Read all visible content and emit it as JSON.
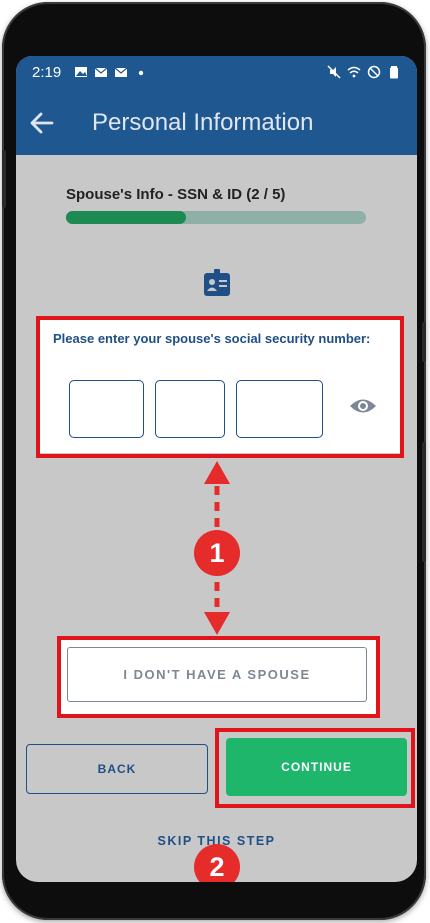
{
  "status_bar": {
    "time": "2:19",
    "left_icons": [
      "image-icon",
      "mail-icon",
      "mail-icon",
      "dot-icon"
    ],
    "right_icons": [
      "mute-icon",
      "wifi-icon",
      "do-not-disturb-icon",
      "battery-icon"
    ]
  },
  "app_bar": {
    "title": "Personal Information"
  },
  "progress": {
    "label": "Spouse's Info - SSN & ID (2 / 5)",
    "fraction": 0.4
  },
  "ssn": {
    "prompt": "Please enter your spouse's social security number:",
    "part1": "",
    "part2": "",
    "part3": ""
  },
  "buttons": {
    "no_spouse": "I DON'T HAVE A SPOUSE",
    "back": "BACK",
    "continue": "CONTINUE",
    "skip": "SKIP THIS STEP"
  },
  "annotations": {
    "badge1": "1",
    "badge2": "2"
  },
  "colors": {
    "app_bar": "#1f5791",
    "accent_green": "#1db66a",
    "progress_fill": "#1c8a51",
    "annotation_red": "#e0151c",
    "primary_text": "#1f4f86"
  }
}
